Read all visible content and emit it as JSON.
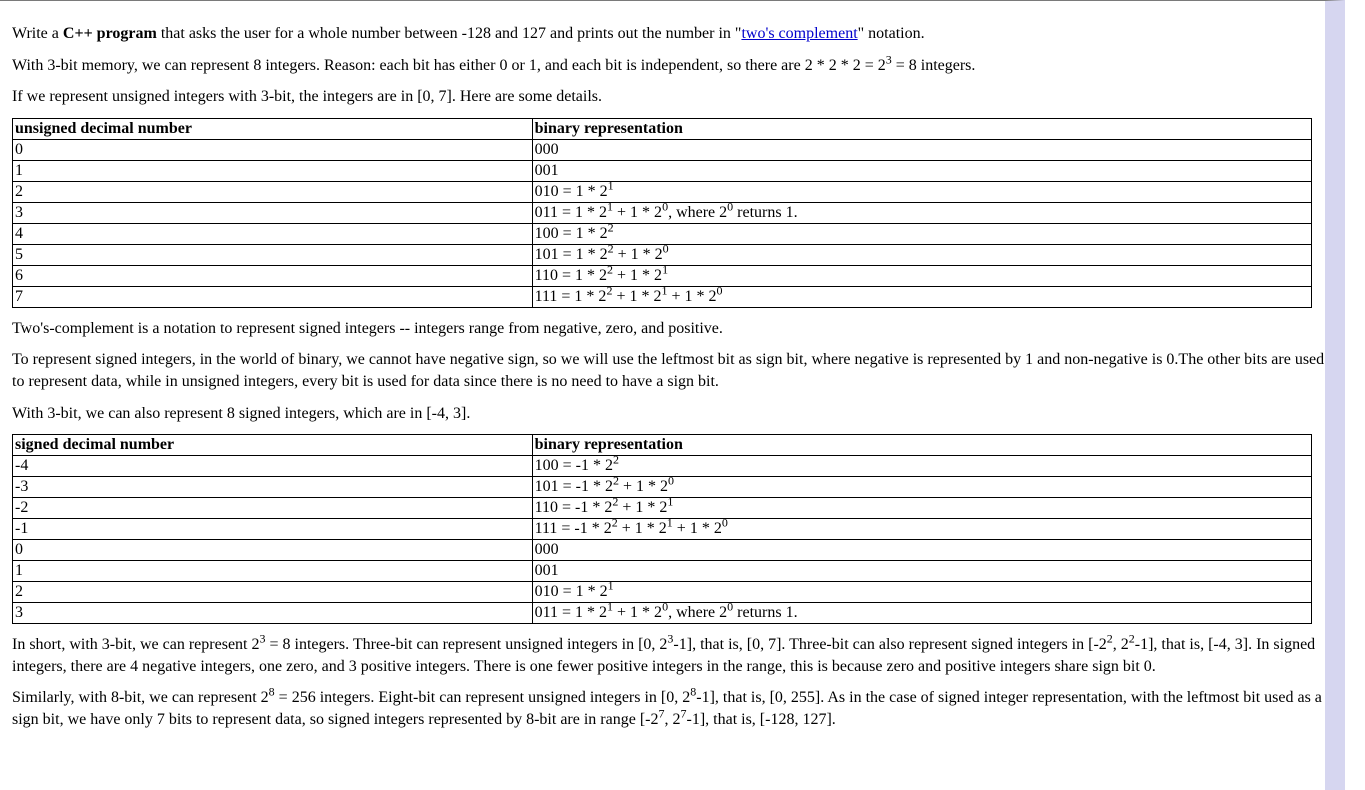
{
  "intro": {
    "para1_pre": "Write a ",
    "para1_bold": "C++ program",
    "para1_mid": " that asks the user for a whole number between -128 and 127 and prints out the number in \"",
    "para1_link": "two's complement",
    "para1_post": "\" notation.",
    "para2": "With 3-bit memory, we can represent 8 integers. Reason: each bit has either 0 or 1, and each bit is independent, so there are 2 * 2 * 2 = 2",
    "para2_sup": "3",
    "para2_post": " = 8 integers.",
    "para3": "If we represent unsigned integers with 3-bit, the integers are in [0, 7]. Here are some details."
  },
  "table1": {
    "h1": "unsigned decimal number",
    "h2": "binary representation",
    "rows": [
      {
        "c1": "0",
        "c2": "000"
      },
      {
        "c1": "1",
        "c2": "001"
      },
      {
        "c1": "2",
        "c2_html": "010 = 1 * 2<sup>1</sup>"
      },
      {
        "c1": "3",
        "c2_html": "011 = 1 * 2<sup>1</sup> + 1 * 2<sup>0</sup>, where 2<sup>0</sup> returns 1."
      },
      {
        "c1": "4",
        "c2_html": "100 = 1 * 2<sup>2</sup>"
      },
      {
        "c1": "5",
        "c2_html": "101 = 1 * 2<sup>2</sup> + 1 * 2<sup>0</sup>"
      },
      {
        "c1": "6",
        "c2_html": "110 = 1 * 2<sup>2</sup> + 1 * 2<sup>1</sup>"
      },
      {
        "c1": "7",
        "c2_html": "111 = 1 * 2<sup>2</sup> + 1 * 2<sup>1</sup> + 1 * 2<sup>0</sup>"
      }
    ]
  },
  "mid": {
    "para4": "Two's-complement is a notation to represent signed integers -- integers range from negative, zero, and positive.",
    "para5": "To represent signed integers, in the world of binary, we cannot have negative sign, so we will use the leftmost bit as sign bit, where negative is represented by 1 and non-negative is 0.The other bits are used to represent data, while in unsigned integers, every bit is used for data since there is no need to have a sign bit.",
    "para6": "With 3-bit, we can also represent 8 signed integers, which are in [-4, 3]."
  },
  "table2": {
    "h1": "signed decimal number",
    "h2": "binary representation",
    "rows": [
      {
        "c1": "-4",
        "c2_html": "100 = -1 * 2<sup>2</sup>"
      },
      {
        "c1": "-3",
        "c2_html": "101 = -1 * 2<sup>2</sup> + 1 * 2<sup>0</sup>"
      },
      {
        "c1": "-2",
        "c2_html": "110 = -1 * 2<sup>2</sup> + 1 * 2<sup>1</sup>"
      },
      {
        "c1": "-1",
        "c2_html": "111 = -1 * 2<sup>2</sup> + 1 * 2<sup>1</sup> + 1 * 2<sup>0</sup>"
      },
      {
        "c1": "0",
        "c2": "000"
      },
      {
        "c1": "1",
        "c2": "001"
      },
      {
        "c1": "2",
        "c2_html": "010 = 1 * 2<sup>1</sup>"
      },
      {
        "c1": "3",
        "c2_html": "011 = 1 * 2<sup>1</sup> + 1 * 2<sup>0</sup>, where 2<sup>0</sup> returns 1."
      }
    ]
  },
  "outro": {
    "para7_html": "In short, with 3-bit, we can represent 2<sup>3</sup> = 8 integers. Three-bit can represent unsigned integers in [0, 2<sup>3</sup>-1], that is, [0, 7]. Three-bit can also represent signed integers in [-2<sup>2</sup>, 2<sup>2</sup>-1], that is, [-4, 3]. In signed integers, there are 4 negative integers, one zero, and 3 positive integers. There is one fewer positive integers in the range, this is because zero and positive integers share sign bit 0.",
    "para8_html": "Similarly, with 8-bit, we can represent 2<sup>8</sup> = 256 integers. Eight-bit can represent unsigned integers in [0, 2<sup>8</sup>-1], that is, [0, 255]. As in the case of signed integer representation, with the leftmost bit used as a sign bit, we have only 7 bits to represent data, so signed integers represented by 8-bit are in range [-2<sup>7</sup>, 2<sup>7</sup>-1], that is, [-128, 127]."
  }
}
